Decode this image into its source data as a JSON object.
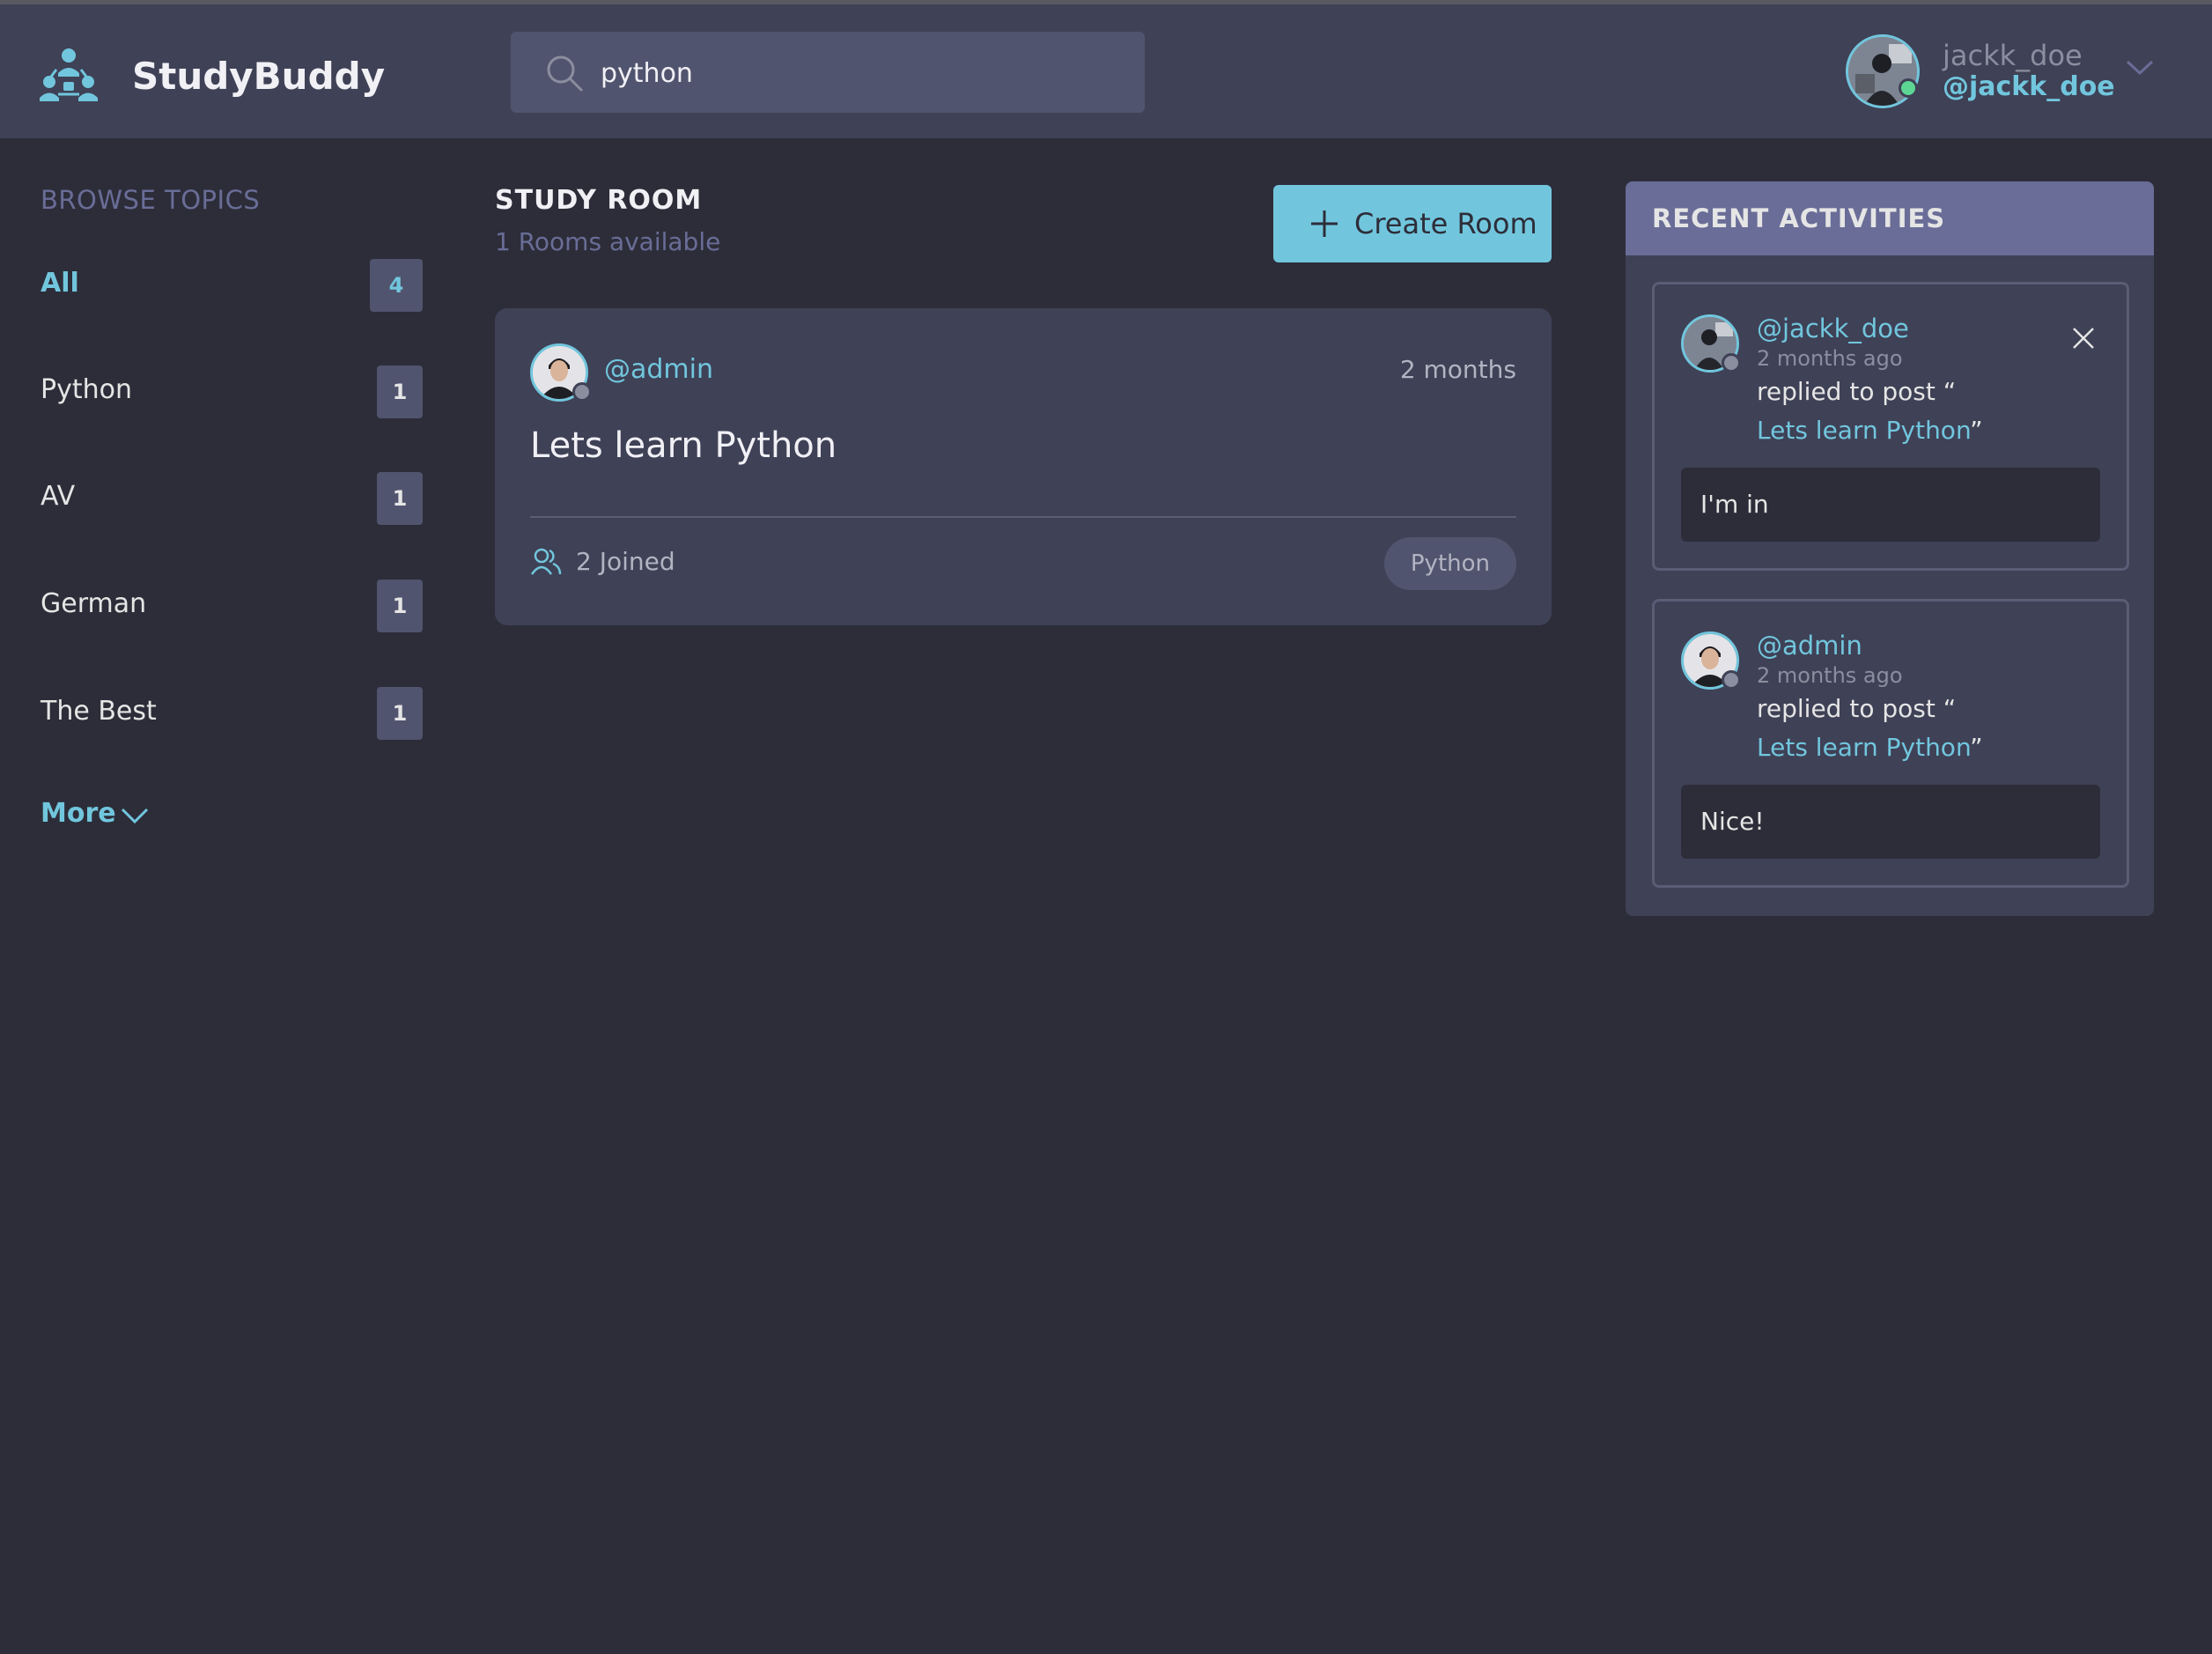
{
  "app": {
    "name": "StudyBuddy",
    "logo_icon": "users-group-logo-icon"
  },
  "search": {
    "value": "python",
    "icon": "search-icon"
  },
  "user": {
    "name": "jackk_doe",
    "handle": "@jackk_doe",
    "status": "online",
    "menu_icon": "chevron-down-icon"
  },
  "sidebar": {
    "title": "BROWSE TOPICS",
    "topics": [
      {
        "label": "All",
        "count": "4",
        "active": true
      },
      {
        "label": "Python",
        "count": "1"
      },
      {
        "label": "AV",
        "count": "1"
      },
      {
        "label": "German",
        "count": "1"
      },
      {
        "label": "The Best",
        "count": "1"
      }
    ],
    "more_label": "More"
  },
  "main": {
    "title": "STUDY ROOM",
    "subtitle": "1 Rooms available",
    "create_label": "Create Room",
    "rooms": [
      {
        "host": "@admin",
        "time": "2 months",
        "title": "Lets learn Python",
        "joined": "2 Joined",
        "topic": "Python"
      }
    ]
  },
  "activities": {
    "title": "RECENT ACTIVITIES",
    "items": [
      {
        "user": "@jackk_doe",
        "time": "2 months ago",
        "action": "replied to post “",
        "post": "Lets learn Python",
        "quote_end": "”",
        "message": "I'm in",
        "deletable": true
      },
      {
        "user": "@admin",
        "time": "2 months ago",
        "action": "replied to post “",
        "post": "Lets learn Python",
        "quote_end": "”",
        "message": "Nice!",
        "deletable": false
      }
    ]
  },
  "colors": {
    "background": "#2d2d39",
    "header": "#3f4156",
    "accent": "#71c6dd",
    "muted": "#696d97",
    "online": "#5dd693"
  }
}
